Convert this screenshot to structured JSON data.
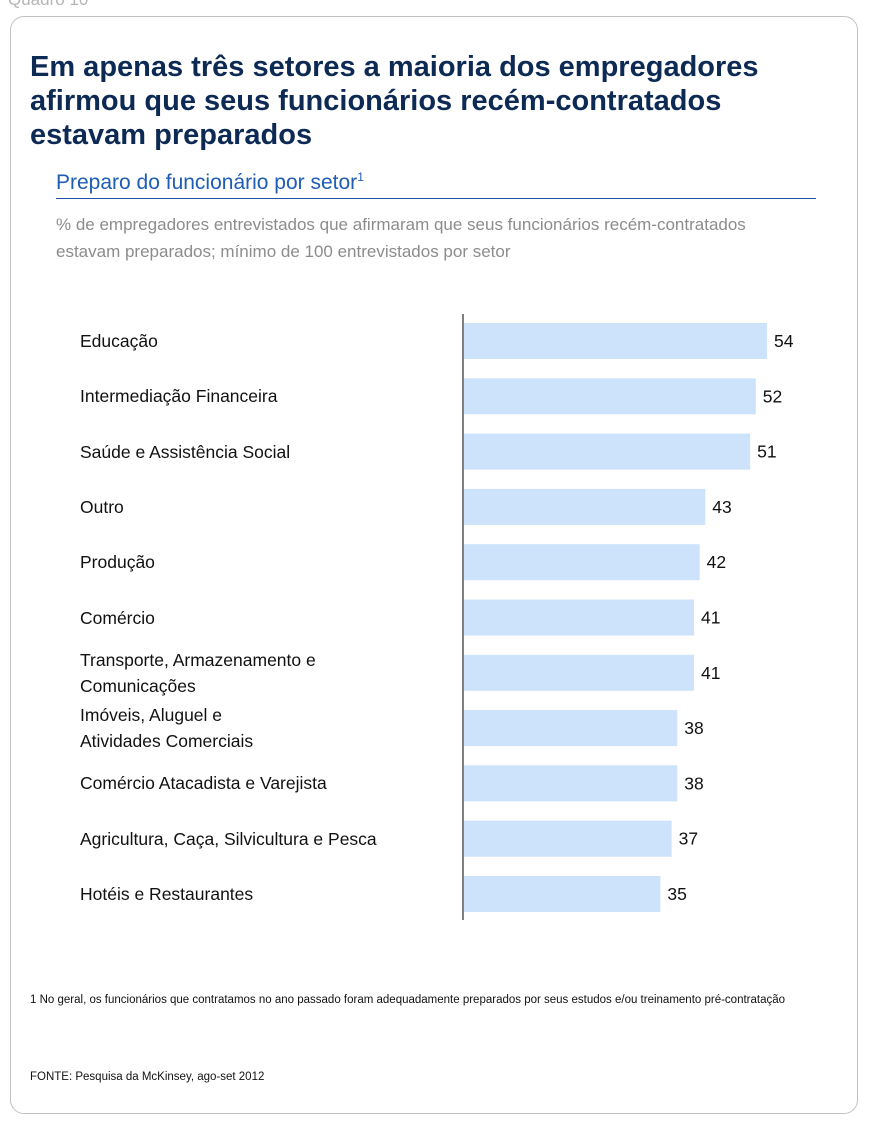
{
  "top_label": "Quadro 10",
  "headline": "Em apenas três setores a maioria dos empregadores afirmou que seus funcionários recém-contratados estavam preparados",
  "subhead": {
    "text": "Preparo do funcionário por setor",
    "footnote_mark": "1"
  },
  "description": "% de empregadores entrevistados que afirmaram que seus funcionários recém-contratados estavam preparados; mínimo de 100 entrevistados por setor",
  "chart_data": {
    "type": "bar",
    "orientation": "horizontal",
    "title": "Preparo do funcionário por setor",
    "categories": [
      [
        "Educação"
      ],
      [
        "Intermediação Financeira"
      ],
      [
        "Saúde e Assistência Social"
      ],
      [
        "Outro"
      ],
      [
        "Produção"
      ],
      [
        "Comércio"
      ],
      [
        "Transporte, Armazenamento e",
        "Comunicações"
      ],
      [
        "Imóveis, Aluguel e",
        "Atividades Comerciais"
      ],
      [
        "Comércio Atacadista e Varejista"
      ],
      [
        "Agricultura, Caça, Silvicultura e Pesca"
      ],
      [
        "Hotéis e Restaurantes"
      ]
    ],
    "values": [
      54,
      52,
      51,
      43,
      42,
      41,
      41,
      38,
      38,
      37,
      35
    ],
    "xlim": [
      0,
      54
    ],
    "grid": false,
    "bar_color": "#cce3fb"
  },
  "footnote": {
    "number": "1",
    "text": "No geral, os funcionários que contratamos no ano passado foram adequadamente preparados por seus estudos e/ou treinamento pré-contratação"
  },
  "source": "FONTE: Pesquisa da McKinsey, ago-set 2012"
}
